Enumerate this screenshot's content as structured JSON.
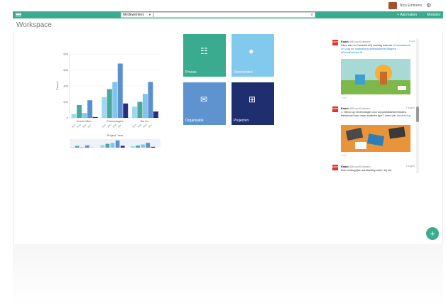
{
  "header": {
    "user_name": "Nico Emmens",
    "avatar_icon": "user-avatar",
    "settings_icon": "gear-icon"
  },
  "nav": {
    "menu_icon": "hamburger-icon",
    "search_scope": "Medewerkers",
    "search_placeholder": "",
    "search_icon": "search-icon",
    "aanmaken_label": "+ Aanmaken",
    "modules_label": "Modules",
    "bar_color": "#3aab8e"
  },
  "page": {
    "title": "Workspace"
  },
  "chart_data": {
    "type": "bar",
    "categories": [
      "Around Wiss...",
      "Eindverslagers",
      "Bar Inv..."
    ],
    "series": [
      {
        "name": "2014",
        "color": "#9fd6f0",
        "values": [
          5,
          26,
          14
        ]
      },
      {
        "name": "2015",
        "color": "#4aa89a",
        "values": [
          16,
          36,
          20
        ]
      },
      {
        "name": "2016",
        "color": "#82c4ea",
        "values": [
          6,
          45,
          30
        ]
      },
      {
        "name": "2017",
        "color": "#5a8fd0",
        "values": [
          22,
          68,
          45
        ]
      },
      {
        "name": "2018",
        "color": "#2a2e7a",
        "values": [
          1,
          18,
          8
        ]
      }
    ],
    "tick_labels": [
      "0",
      "200",
      "400",
      "600",
      "800"
    ],
    "xlabel": "Project, Year",
    "ylabel": "Faced",
    "ylim": [
      0,
      80
    ],
    "sub_ticks": [
      "2014",
      "2015",
      "2016",
      "2017"
    ]
  },
  "tiles": [
    {
      "label": "Proces",
      "icon": "checklist-icon",
      "color": "#3aab8e"
    },
    {
      "label": "Overzichten",
      "icon": "globe-icon",
      "color": "#82c9ee"
    },
    {
      "label": "Organisatie",
      "icon": "people-icon",
      "color": "#5e93d0"
    },
    {
      "label": "Projecten",
      "icon": "sitemap-icon",
      "color": "#1f2e6e"
    }
  ],
  "tweets": [
    {
      "logo": "EXACT",
      "author": "Exact",
      "handle": "@ExactSoftware",
      "time": "5 uur",
      "text": "Alles aan in Canada! Wij zondag naar de",
      "hashtags": "#Canadian19 en volg de ontdekking @MaastrichtVillagers #ExactPartner #1"
    },
    {
      "logo": "EXACT",
      "author": "Exact",
      "handle": "@ExactSoftware",
      "time": "2 dagen",
      "text": "1. Steun op technologie voor topontwikkelmethodes. Benieuwd hoe onze anderen tips? Lees via:",
      "hashtags": "#exactblog"
    },
    {
      "logo": "EXACT",
      "author": "Exact",
      "handle": "@ExactSoftware",
      "time": "3 dagen",
      "text": "Drie belangrijke aandachtspunten bij het",
      "hashtags": ""
    }
  ],
  "fabs": [
    {
      "icon": "plus-icon",
      "color": "#3aab8e"
    },
    {
      "icon": "plus-icon",
      "color": "#d4ede5"
    }
  ]
}
